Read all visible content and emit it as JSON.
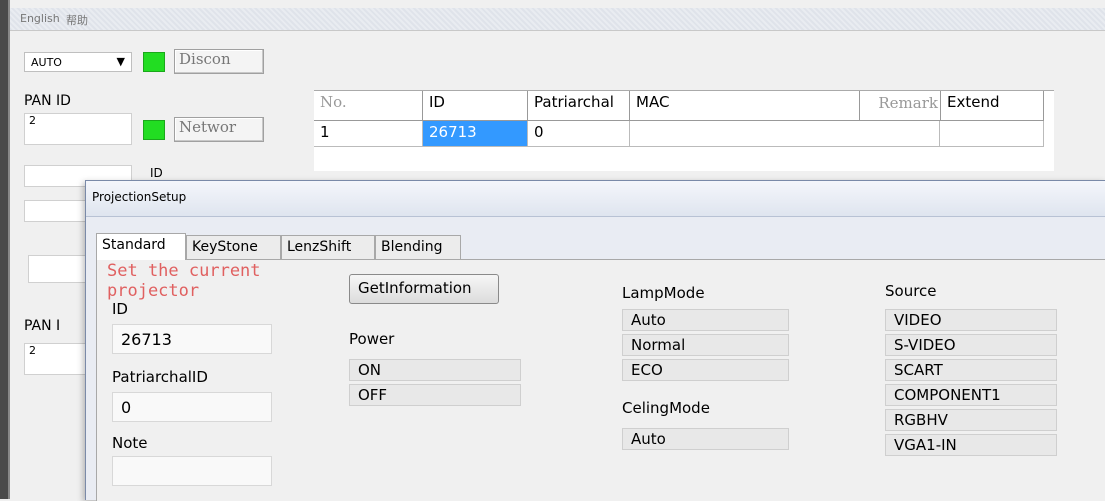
{
  "menu": {
    "english": "English",
    "help": "帮助"
  },
  "top": {
    "mode_value": "AUTO",
    "dropdown_arrow": "▼",
    "discon_label": "Discon",
    "pan_id_label": "PAN ID",
    "pan_id_value": "2",
    "network_label": "Networ",
    "pan2_label": "PAN I",
    "pan2_value": "2",
    "id_partial": "ID"
  },
  "table": {
    "headers": [
      "No.",
      "ID",
      "Patriarchal",
      "MAC",
      "Remark",
      "Extend"
    ],
    "rows": [
      [
        "1",
        "26713",
        "0",
        "",
        "",
        ""
      ]
    ]
  },
  "dialog": {
    "title": "ProjectionSetup",
    "tabs": [
      "Standard",
      "KeyStone",
      "LenzShift",
      "Blending"
    ],
    "active_tab": "Standard",
    "set_current_line1": "Set the current",
    "set_current_line2": "projector",
    "id_label": "ID",
    "id_value": "26713",
    "patriarchal_label": "PatriarchalID",
    "patriarchal_value": "0",
    "note_label": "Note",
    "get_info_label": "GetInformation",
    "power_label": "Power",
    "power_options": [
      "ON",
      "OFF"
    ],
    "lamp_label": "LampMode",
    "lamp_options": [
      "Auto",
      "Normal",
      "ECO"
    ],
    "celing_label": "CelingMode",
    "celing_options": [
      "Auto"
    ],
    "source_label": "Source",
    "source_options": [
      "VIDEO",
      "S-VIDEO",
      "SCART",
      "COMPONENT1",
      "RGBHV",
      "VGA1-IN"
    ]
  },
  "colors": {
    "status_green": "#22dd22",
    "selection_blue": "#3399ff",
    "hint_red": "#e06060"
  }
}
